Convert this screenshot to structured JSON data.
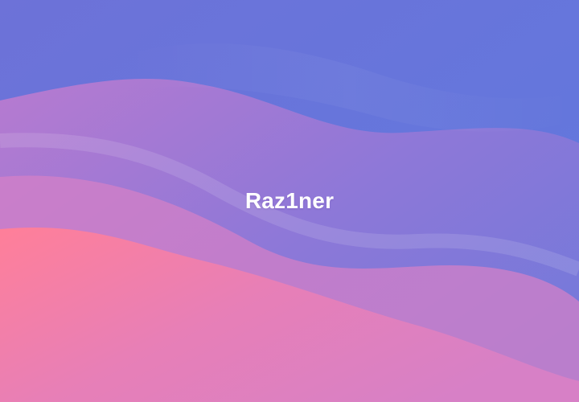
{
  "screen": {
    "title": "Raz1ner",
    "wallpaper": {
      "kind": "abstract-waves",
      "colors": {
        "top_blue": "#6b73d8",
        "violet": "#8f7ad6",
        "lilac": "#c97fca",
        "pink": "#f07fae",
        "coral": "#ff7f93"
      }
    }
  }
}
